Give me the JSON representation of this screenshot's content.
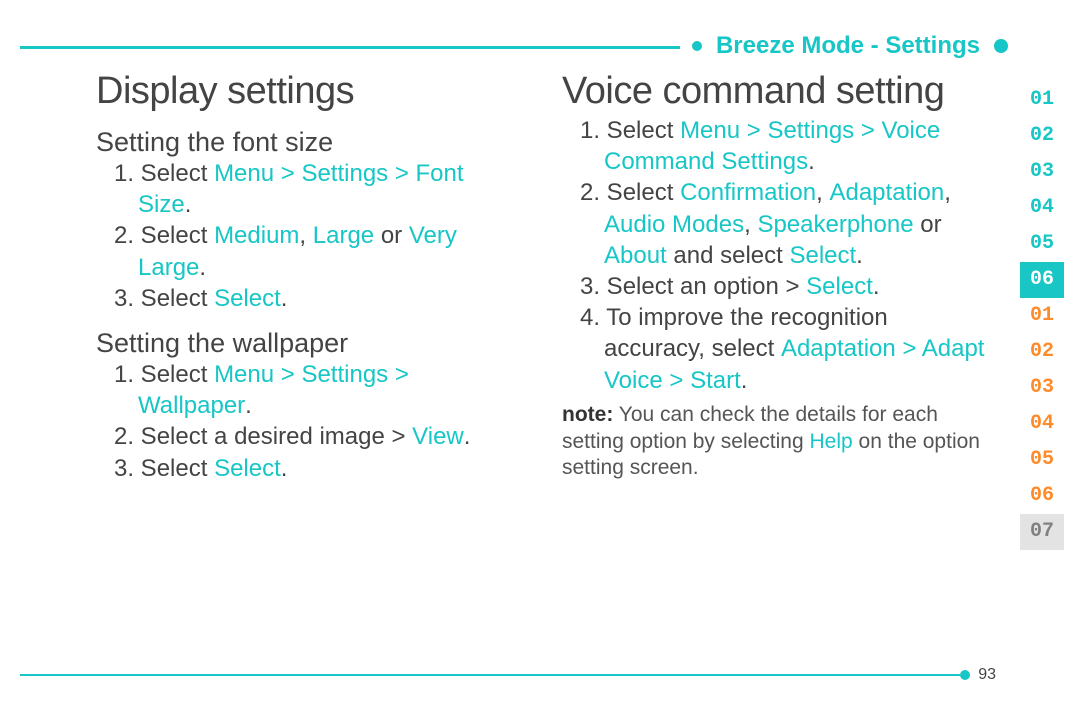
{
  "breadcrumb": "Breeze Mode - Settings",
  "page_number": "93",
  "left": {
    "h1": "Display settings",
    "sec1_h2": "Setting the font size",
    "sec1_step1_pre": "1. Select ",
    "sec1_step1_hl": "Menu > Settings > Font Size",
    "sec1_step1_post": ".",
    "sec1_step2_pre": "2. Select ",
    "sec1_step2_hl1": "Medium",
    "sec1_step2_mid1": ", ",
    "sec1_step2_hl2": "Large",
    "sec1_step2_mid2": " or ",
    "sec1_step2_hl3": "Very Large",
    "sec1_step2_post": ".",
    "sec1_step3_pre": "3. Select ",
    "sec1_step3_hl": "Select",
    "sec1_step3_post": ".",
    "sec2_h2": "Setting the wallpaper",
    "sec2_step1_pre": "1. Select ",
    "sec2_step1_hl": "Menu > Settings > Wallpaper",
    "sec2_step1_post": ".",
    "sec2_step2_pre": "2. Select  a desired image > ",
    "sec2_step2_hl": "View",
    "sec2_step2_post": ".",
    "sec2_step3_pre": "3. Select ",
    "sec2_step3_hl": "Select",
    "sec2_step3_post": "."
  },
  "right": {
    "h1": "Voice command setting",
    "step1_pre": "1. Select ",
    "step1_hl": "Menu > Settings > Voice Command Settings",
    "step1_post": ".",
    "step2_pre": "2. Select ",
    "step2_hl1": "Confirmation",
    "step2_mid1": ", ",
    "step2_hl2": "Adaptation",
    "step2_mid2": ", ",
    "step2_hl3": "Audio Modes",
    "step2_mid3": ", ",
    "step2_hl4": "Speakerphone",
    "step2_mid4": " or ",
    "step2_hl5": "About",
    "step2_mid5": " and select ",
    "step2_hl6": "Select",
    "step2_post": ".",
    "step3_pre": "3. Select an option > ",
    "step3_hl": "Select",
    "step3_post": ".",
    "step4_pre": "4. To improve the recognition accuracy, select ",
    "step4_hl": "Adaptation > Adapt Voice > Start",
    "step4_post": ".",
    "note_b": "note:",
    "note_pre": " You can check the details for each setting option by selecting ",
    "note_hl": "Help",
    "note_post": " on the option setting screen."
  },
  "tabs": [
    "01",
    "02",
    "03",
    "04",
    "05",
    "06",
    "01",
    "02",
    "03",
    "04",
    "05",
    "06",
    "07"
  ],
  "tabs_active_index": 5,
  "tabs_orange_start": 6,
  "tabs_grey_start": 12
}
